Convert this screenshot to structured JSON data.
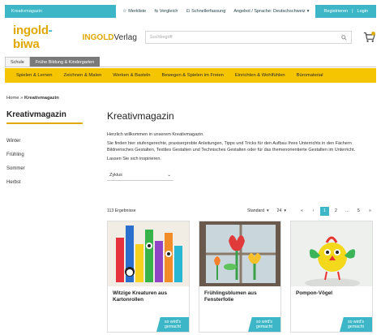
{
  "topbar": {
    "brand_link": "Kreativmagazin",
    "links": [
      {
        "icon": "star-icon",
        "label": "Merkliste"
      },
      {
        "icon": "compare-icon",
        "label": "Vergleich"
      },
      {
        "icon": "cart-icon",
        "label": "Schnellerfassung"
      }
    ],
    "language": "Angebot / Sprache: Deutschschweiz",
    "register": "Registrieren",
    "separator": "|",
    "login": "Login"
  },
  "logo": {
    "brand_part1": "ingold",
    "brand_dash": "-",
    "brand_part2": "biwa",
    "publisher_bold": "INGOLD",
    "publisher_rest": "Verlag"
  },
  "search": {
    "placeholder": "Suchbegriff"
  },
  "tabs": [
    {
      "label": "Schule"
    },
    {
      "label": "Frühe Bildung & Kindergarten"
    }
  ],
  "categories": [
    "Spielen & Lernen",
    "Zeichnen & Malen",
    "Werken & Basteln",
    "Bewegen & Spielen im Freien",
    "Einrichten & Wohlfühlen",
    "Büromaterial"
  ],
  "breadcrumb": {
    "home": "Home",
    "separator": "»",
    "current": "Kreativmagazin"
  },
  "sidebar": {
    "title": "Kreativmagazin",
    "items": [
      "Winter",
      "Frühling",
      "Sommer",
      "Herbst"
    ]
  },
  "main": {
    "title": "Kreativmagazin",
    "intro": "Herzlich willkommen in unserem Kreativmagazin.",
    "body": "Sie finden hier stufengerechte, praxiserprobte Anleitungen, Tipps und Tricks für den Aufbau Ihres Unterrichts in den Fächern Bildnerisches Gestalten, Textiles Gestalten und Technisches Gestalten oder für das themenorientierte Gestalten im Unterricht.",
    "cta": "Lassen Sie sich inspirieren.",
    "filter_label": "Zyklus"
  },
  "toolbar": {
    "results": "113 Ergebnisse",
    "sort": "Standard",
    "per_page": "24",
    "pages": [
      "«",
      "‹",
      "1",
      "2",
      "…",
      "5",
      "»"
    ]
  },
  "cards": [
    {
      "name": "Witzige Kreaturen aus Kartonrollen",
      "cta": "so wird's gemacht"
    },
    {
      "name": "Frühlingsblumen aus Fensterfolie",
      "cta": "so wird's gemacht"
    },
    {
      "name": "Pompon-Vögel",
      "cta": "so wird's gemacht"
    }
  ],
  "colors": {
    "accent": "#3db7c7",
    "yellow": "#f4c500",
    "brand": "#e0a800"
  }
}
